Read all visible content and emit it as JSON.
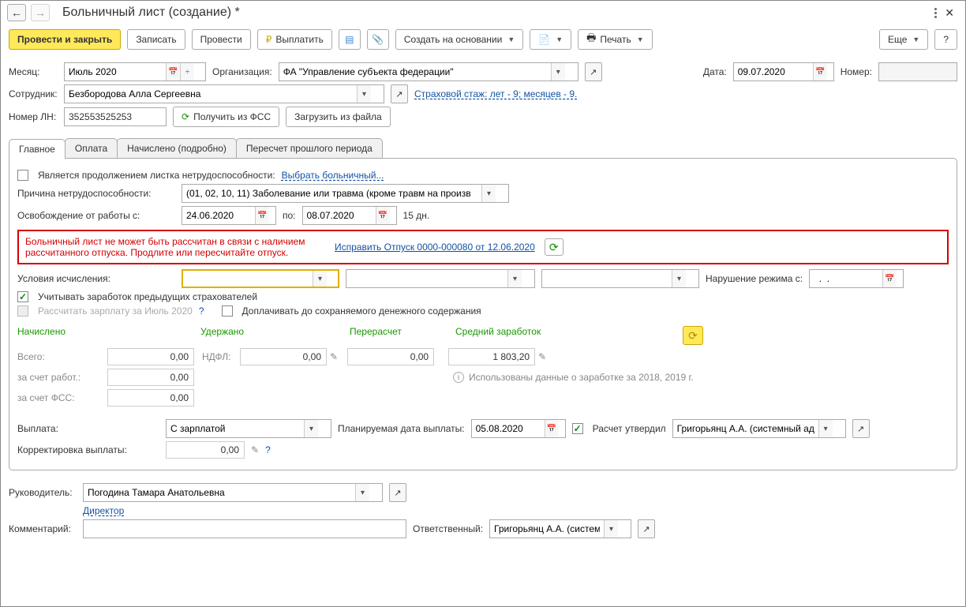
{
  "titlebar": {
    "title": "Больничный лист (создание) *"
  },
  "toolbar": {
    "post_close": "Провести и закрыть",
    "save": "Записать",
    "post": "Провести",
    "pay": "Выплатить",
    "create_based": "Создать на основании",
    "print": "Печать",
    "more": "Еще",
    "help": "?"
  },
  "header": {
    "month_lbl": "Месяц:",
    "month": "Июль 2020",
    "org_lbl": "Организация:",
    "org": "ФА \"Управление субъекта федерации\"",
    "date_lbl": "Дата:",
    "date": "09.07.2020",
    "num_lbl": "Номер:",
    "num": "",
    "employee_lbl": "Сотрудник:",
    "employee": "Безбородова Алла Сергеевна",
    "insurance_link": "Страховой стаж: лет - 9; месяцев - 9.",
    "ln_lbl": "Номер ЛН:",
    "ln": "352553525253",
    "get_fss": "Получить из ФСС",
    "load_file": "Загрузить из файла"
  },
  "tabs": {
    "t1": "Главное",
    "t2": "Оплата",
    "t3": "Начислено (подробно)",
    "t4": "Пересчет прошлого периода"
  },
  "main": {
    "continuation_lbl": "Является продолжением листка нетрудоспособности:",
    "choose_sick": "Выбрать больничный...",
    "reason_lbl": "Причина нетрудоспособности:",
    "reason": "(01, 02, 10, 11) Заболевание или травма (кроме травм на произв",
    "release_lbl": "Освобождение от работы с:",
    "from": "24.06.2020",
    "to_lbl": "по:",
    "to": "08.07.2020",
    "days": "15 дн.",
    "error_msg": "Больничный лист не может быть рассчитан в связи с наличием рассчитанного отпуска. Продлите или пересчитайте отпуск.",
    "fix_link": "Исправить Отпуск 0000-000080 от 12.06.2020",
    "calc_cond_lbl": "Условия исчисления:",
    "violation_lbl": "Нарушение режима с:",
    "violation": "  .  .    ",
    "consider_prev": "Учитывать заработок предыдущих страхователей",
    "recalc_salary": "Рассчитать зарплату за Июль 2020",
    "supplement": "Доплачивать до сохраняемого денежного содержания"
  },
  "totals": {
    "accrued_h": "Начислено",
    "withheld_h": "Удержано",
    "recalc_h": "Перерасчет",
    "avg_h": "Средний заработок",
    "total_lbl": "Всего:",
    "total_accrued": "0,00",
    "ndfl_lbl": "НДФЛ:",
    "ndfl": "0,00",
    "recalc": "0,00",
    "avg": "1 803,20",
    "employer_lbl": "за счет работ.:",
    "employer": "0,00",
    "fss_lbl": "за счет ФСС:",
    "fss": "0,00",
    "info": "Использованы данные о заработке за 2018,  2019 г."
  },
  "payment": {
    "pay_lbl": "Выплата:",
    "pay": "С зарплатой",
    "plan_date_lbl": "Планируемая дата выплаты:",
    "plan_date": "05.08.2020",
    "approved_lbl": "Расчет утвердил",
    "approved_by": "Григорьянц А.А. (системный адми",
    "corr_lbl": "Корректировка выплаты:",
    "corr": "0,00"
  },
  "footer": {
    "manager_lbl": "Руководитель:",
    "manager": "Погодина Тамара Анатольевна",
    "position": "Директор",
    "comment_lbl": "Комментарий:",
    "comment": "",
    "resp_lbl": "Ответственный:",
    "resp": "Григорьянц А.А. (системн"
  }
}
